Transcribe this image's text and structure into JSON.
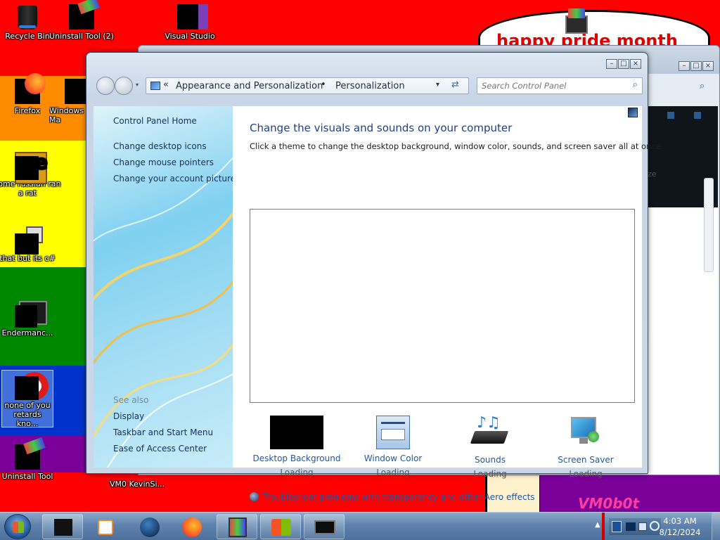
{
  "desktop": {
    "icons": [
      {
        "label": "Recycle Bin"
      },
      {
        "label": "Uninstall Tool (2)"
      },
      {
        "label": "Visual Studio"
      },
      {
        "label": "Firefox"
      },
      {
        "label": "Windows Ma"
      },
      {
        "label": "some russian ran a rat"
      },
      {
        "label": "that but its c#"
      },
      {
        "label": "Endermanc..."
      },
      {
        "label": "none of you retards kno..."
      },
      {
        "label": "Uninstall Tool"
      },
      {
        "label": "VM0 KevinSi..."
      }
    ],
    "wallpaper_text": {
      "banner": "happy pride month",
      "signature": "VM0b0t"
    },
    "stripe_colors": [
      "#ff0000",
      "#ff8c00",
      "#ffff00",
      "#008800",
      "#0033cc",
      "#7a0099"
    ]
  },
  "window": {
    "breadcrumb": [
      "Appearance and Personalization",
      "Personalization"
    ],
    "search_placeholder": "Search Control Panel",
    "left_links": [
      "Control Panel Home",
      "Change desktop icons",
      "Change mouse pointers",
      "Change your account picture"
    ],
    "see_also_title": "See also",
    "see_also_links": [
      "Display",
      "Taskbar and Start Menu",
      "Ease of Access Center"
    ],
    "heading": "Change the visuals and sounds on your computer",
    "subheading": "Click a theme to change the desktop background, window color, sounds, and screen saver all at once.",
    "options": [
      {
        "label": "Desktop Background",
        "status": "Loading"
      },
      {
        "label": "Window Color",
        "status": "Loading"
      },
      {
        "label": "Sounds",
        "status": "Loading"
      },
      {
        "label": "Screen Saver",
        "status": "Loading"
      }
    ],
    "troubleshoot": "Troubleshoot problems with transparency and other Aero effects",
    "bg_window_text": "ze"
  },
  "taskbar": {
    "time": "4:03 AM",
    "date": "8/12/2024"
  }
}
